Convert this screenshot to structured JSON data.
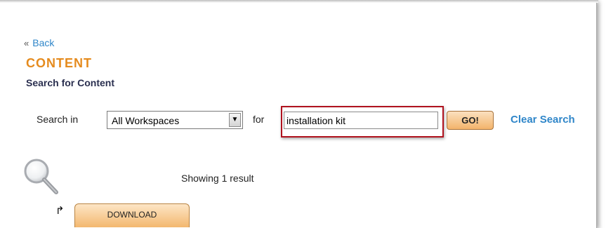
{
  "nav": {
    "back_arrows": "«",
    "back_label": "Back"
  },
  "header": {
    "title": "CONTENT",
    "subtitle": "Search for Content"
  },
  "search": {
    "search_in_label": "Search in",
    "workspace_selected": "All Workspaces",
    "for_label": "for",
    "query_value": "installation kit",
    "go_label": "GO!",
    "clear_label": "Clear Search"
  },
  "results": {
    "summary": "Showing 1 result",
    "return_glyph": "↱",
    "download_label": "DOWNLOAD"
  },
  "colors": {
    "accent_orange": "#e58b1e",
    "link_blue": "#2f86c9",
    "highlight_red": "#b0121e",
    "button_gradient_top": "#fbe0bf",
    "button_gradient_bottom": "#f3b46b"
  },
  "icons": {
    "results_icon": "magnifier-icon",
    "select_arrow": "chevron-down-icon"
  }
}
